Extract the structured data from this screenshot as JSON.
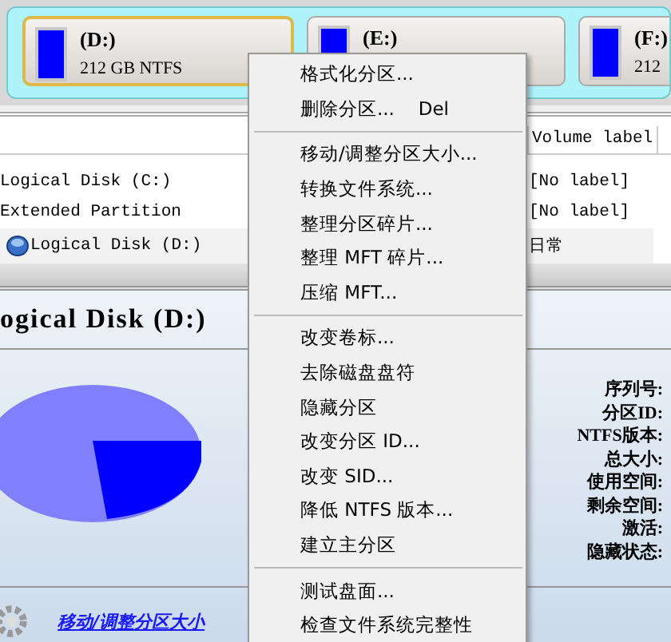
{
  "partition_cards": [
    {
      "name": "(D:)",
      "info": "212 GB NTFS",
      "selected": true
    },
    {
      "name": "(E:)",
      "selected": false
    },
    {
      "name": "(F:)",
      "info": "212",
      "selected": false
    }
  ],
  "partition_table": {
    "columns": [
      "Volume label"
    ],
    "rows": [
      {
        "kind": "plain",
        "name": "Logical Disk (C:)",
        "volume_label": "[No label]",
        "selected": false
      },
      {
        "kind": "plain",
        "name": "Extended Partition",
        "volume_label": "[No label]",
        "selected": false
      },
      {
        "kind": "disk",
        "name": "Logical Disk (D:)",
        "volume_label": "日常",
        "selected": true
      }
    ]
  },
  "details": {
    "title": "ogical Disk (D:)",
    "properties": [
      "序列号:",
      "分区ID:",
      "NTFS版本:",
      "总大小:",
      "使用空间:",
      "剩余空间:",
      "激活:",
      "隐藏状态:"
    ],
    "link": "移动/调整分区大小"
  },
  "context_menu": {
    "sections": [
      [
        {
          "label": "格式化分区..."
        },
        {
          "label": "删除分区...",
          "shortcut": "Del"
        }
      ],
      [
        {
          "label": "移动/调整分区大小..."
        },
        {
          "label": "转换文件系统..."
        },
        {
          "label": "整理分区碎片..."
        },
        {
          "label": "整理 MFT 碎片..."
        },
        {
          "label": "压缩 MFT..."
        }
      ],
      [
        {
          "label": "改变卷标..."
        },
        {
          "label": "去除磁盘盘符"
        },
        {
          "label": "隐藏分区"
        },
        {
          "label": "改变分区 ID..."
        },
        {
          "label": "改变 SID..."
        },
        {
          "label": "降低 NTFS 版本..."
        },
        {
          "label": "建立主分区"
        }
      ],
      [
        {
          "label": "测试盘面..."
        },
        {
          "label": "检查文件系统完整性"
        }
      ]
    ]
  }
}
